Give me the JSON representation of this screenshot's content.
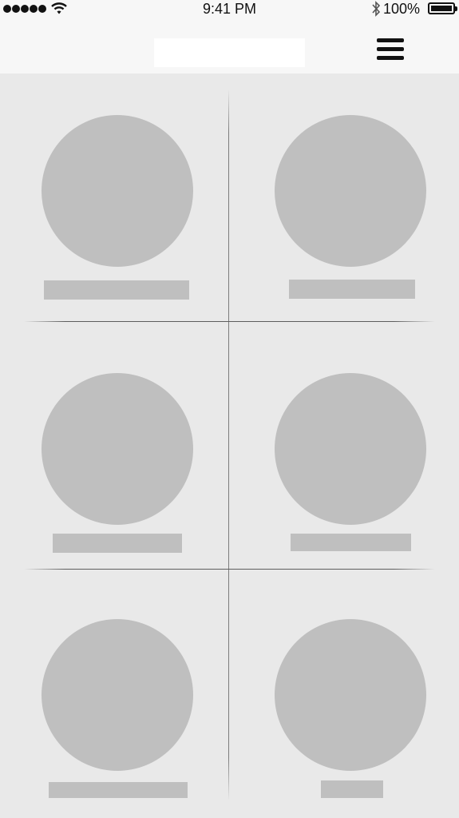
{
  "status_bar": {
    "time": "9:41 PM",
    "battery_percent": "100%",
    "signal_icon": "signal-dots-icon",
    "wifi_icon": "wifi-icon",
    "bluetooth_icon": "bluetooth-icon",
    "battery_icon": "battery-icon"
  },
  "nav_bar": {
    "menu_icon": "hamburger-menu-icon"
  },
  "grid": {
    "columns": 2,
    "rows": 3,
    "item_count": 6
  },
  "colors": {
    "background": "#e9e9e9",
    "bar_background": "#f7f7f7",
    "placeholder": "#bfbfbf",
    "title_placeholder": "#ffffff",
    "divider": "#7d7d7d"
  }
}
